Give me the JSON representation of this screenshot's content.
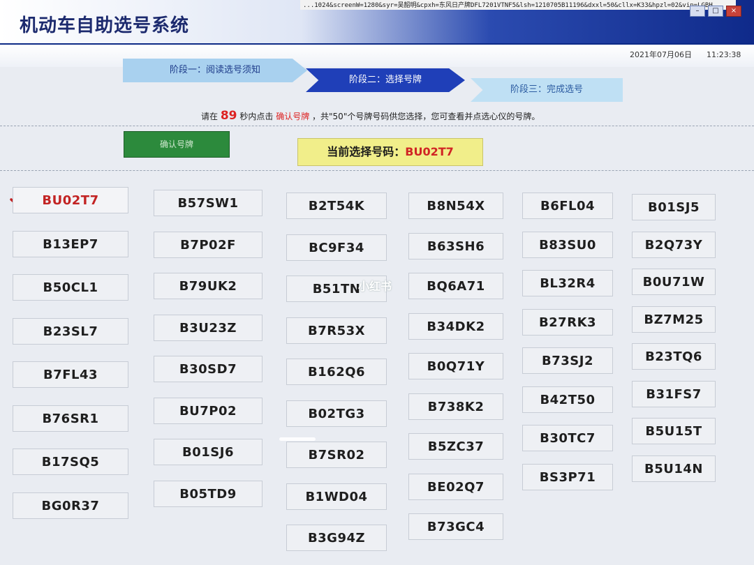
{
  "window": {
    "title": "机动车自助选号系统",
    "url": "...1024&screenW=1280&syr=吴韶明&cpxh=东风日产牌DFL7201VTNF5&lsh=1210705B11196&dxxl=50&cllx=K33&hpzl=02&vin=LGBH"
  },
  "header": {
    "date": "2021年07月06日",
    "time": "11:23:38"
  },
  "steps": [
    {
      "label": "阶段一：阅读选号须知",
      "state": "done"
    },
    {
      "label": "阶段二：选择号牌",
      "state": "active"
    },
    {
      "label": "阶段三：完成选号",
      "state": "pending"
    }
  ],
  "instruction": {
    "prefix": "请在",
    "seconds": "89",
    "middle": "秒内点击",
    "action": "确认号牌",
    "suffix": "，共\"50\"个号牌号码供您选择，您可查看并点选心仪的号牌。"
  },
  "confirm_button": {
    "label": "确认号牌"
  },
  "current": {
    "label": "当前选择号码：",
    "code": "BU02T7"
  },
  "plates": [
    [
      "BU02T7",
      "B13EP7",
      "B50CL1",
      "B23SL7",
      "B7FL43",
      "B76SR1",
      "B17SQ5",
      "BG0R37"
    ],
    [
      "B57SW1",
      "B7P02F",
      "B79UK2",
      "B3U23Z",
      "B30SD7",
      "BU7P02",
      "B01SJ6",
      "B05TD9"
    ],
    [
      "B2T54K",
      "BC9F34",
      "B51TN",
      "B7R53X",
      "B162Q6",
      "B02TG3",
      "B7SR02",
      "B1WD04",
      "B3G94Z"
    ],
    [
      "B8N54X",
      "B63SH6",
      "BQ6A71",
      "B34DK2",
      "B0Q71Y",
      "B738K2",
      "B5ZC37",
      "BE02Q7",
      "B73GC4"
    ],
    [
      "B6FL04",
      "B83SU0",
      "BL32R4",
      "B27RK3",
      "B73SJ2",
      "B42T50",
      "B30TC7",
      "BS3P71"
    ],
    [
      "B01SJ5",
      "B2Q73Y",
      "B0U71W",
      "BZ7M25",
      "B23TQ6",
      "B31FS7",
      "B5U15T",
      "B5U14N"
    ]
  ],
  "selected_plate": "BU02T7",
  "watermark": "小红书",
  "colors": {
    "accent": "#1f3fb8",
    "selected": "#c22323",
    "confirm": "#2c8a3c",
    "highlight": "#f1ee8a"
  }
}
